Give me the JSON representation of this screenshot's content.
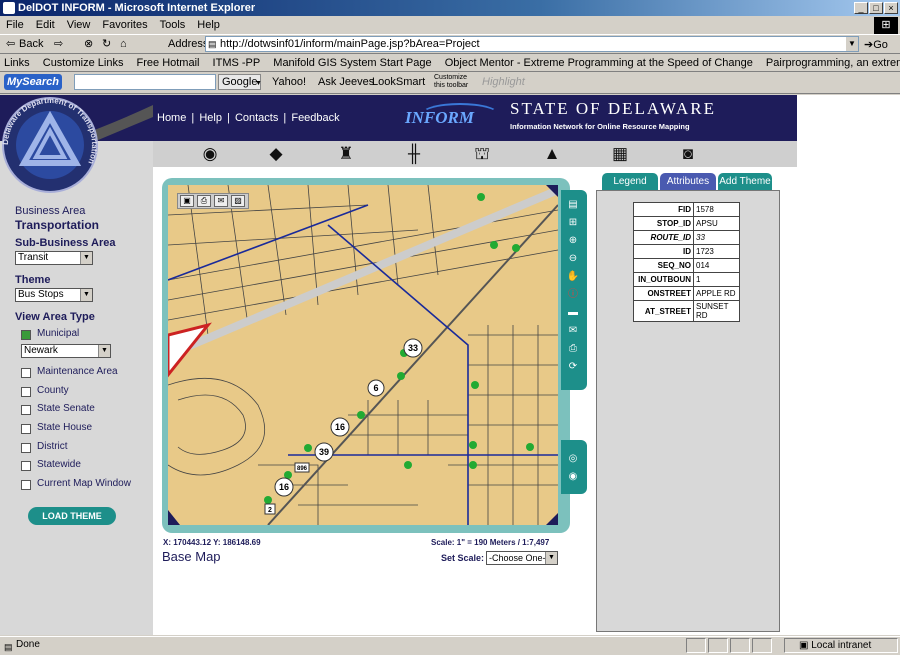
{
  "window": {
    "title": "DelDOT INFORM - Microsoft Internet Explorer"
  },
  "menu": [
    "File",
    "Edit",
    "View",
    "Favorites",
    "Tools",
    "Help"
  ],
  "toolbar": {
    "back": "Back",
    "address_label": "Address",
    "url": "http://dotwsinf01/inform/mainPage.jsp?bArea=Project",
    "go": "Go"
  },
  "links": {
    "label": "Links",
    "items": [
      "Customize Links",
      "Free Hotmail",
      "ITMS -PP",
      "Manifold GIS System Start Page",
      "Object Mentor - Extreme Programming at the Speed of Change",
      "Pairprogramming, an extreme programming practice"
    ]
  },
  "searchbar": {
    "brand": "MySearch",
    "google": "Google",
    "items": [
      "Yahoo!",
      "Ask Jeeves",
      "LookSmart"
    ],
    "customize": "Customize this toolbar",
    "highlight": "Highlight"
  },
  "header": {
    "nav": [
      "Home",
      "Help",
      "Contacts",
      "Feedback"
    ],
    "separator": "|",
    "state_title": "STATE OF DELAWARE",
    "state_sub": "Information Network for Online Resource Mapping",
    "inform_logo": "INFORM",
    "logo_ring_text": "Delaware Department of Transportation"
  },
  "sidebar": {
    "business_area_label": "Business Area",
    "business_area_value": "Transportation",
    "sub_business_area_label": "Sub-Business Area",
    "sub_business_area_value": "Transit",
    "theme_label": "Theme",
    "theme_value": "Bus Stops",
    "view_area_label": "View Area Type",
    "options": [
      {
        "label": "Municipal",
        "checked": true
      },
      {
        "label": "Maintenance Area"
      },
      {
        "label": "County"
      },
      {
        "label": "State Senate"
      },
      {
        "label": "State House"
      },
      {
        "label": "District"
      },
      {
        "label": "Statewide"
      },
      {
        "label": "Current Map Window"
      }
    ],
    "municipal_value": "Newark",
    "load_theme": "LOAD THEME"
  },
  "map": {
    "coords": "X: 170443.12 Y: 186148.69",
    "scale": "Scale: 1\" = 190 Meters / 1:7,497",
    "base_map": "Base Map",
    "set_scale_label": "Set Scale:",
    "set_scale_value": "-Choose One-",
    "route_labels": [
      "33",
      "6",
      "16",
      "39",
      "16",
      "2",
      "896"
    ]
  },
  "panel": {
    "tabs": [
      "Legend",
      "Attributes",
      "Add Theme"
    ],
    "active_tab": "Attributes",
    "attributes": [
      {
        "k": "FID",
        "v": "1578"
      },
      {
        "k": "STOP_ID",
        "v": "APSU"
      },
      {
        "k": "ROUTE_ID",
        "v": "33"
      },
      {
        "k": "ID",
        "v": "1723"
      },
      {
        "k": "SEQ_NO",
        "v": "014"
      },
      {
        "k": "IN_OUTBOUN",
        "v": "1"
      },
      {
        "k": "ONSTREET",
        "v": "APPLE RD"
      },
      {
        "k": "AT_STREET",
        "v": "SUNSET RD"
      }
    ]
  },
  "status": {
    "text": "Done",
    "zone": "Local intranet"
  },
  "colors": {
    "navy": "#1e1c5a",
    "teal": "#1d8f8a",
    "map_bg": "#e8c988",
    "stop": "#22aa33"
  }
}
